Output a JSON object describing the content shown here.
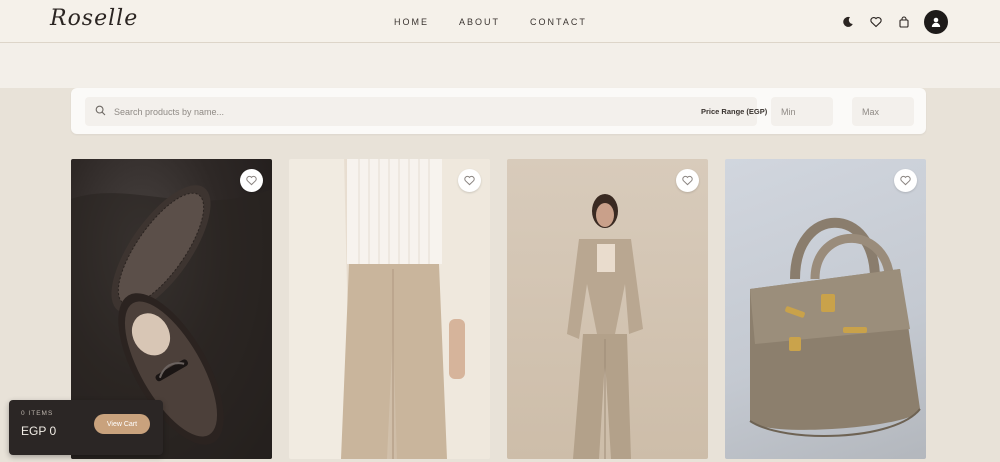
{
  "header": {
    "logo": "Roselle",
    "nav": [
      {
        "label": "HOME"
      },
      {
        "label": "ABOUT"
      },
      {
        "label": "CONTACT"
      }
    ],
    "icons": [
      "moon-icon",
      "heart-icon",
      "bag-icon",
      "user-icon"
    ]
  },
  "search": {
    "placeholder": "Search products by name...",
    "value": "",
    "price_label": "Price Range (EGP)",
    "min_placeholder": "Min",
    "max_placeholder": "Max"
  },
  "products": [
    {
      "image": "brown-leather-loafers",
      "wishlist_icon": "heart-outline-icon"
    },
    {
      "image": "cream-blazer-beige-trousers",
      "wishlist_icon": "heart-outline-icon"
    },
    {
      "image": "beige-pantsuit-model",
      "wishlist_icon": "heart-outline-icon"
    },
    {
      "image": "taupe-leather-handbag",
      "wishlist_icon": "heart-outline-icon"
    }
  ],
  "cart": {
    "items_label": "0 ITEMS",
    "total": "EGP 0",
    "button_label": "View Cart"
  },
  "colors": {
    "background": "#e8e2d8",
    "header": "#f5f1ea",
    "accent": "#c9a27d",
    "cart_panel": "#2b2625"
  }
}
